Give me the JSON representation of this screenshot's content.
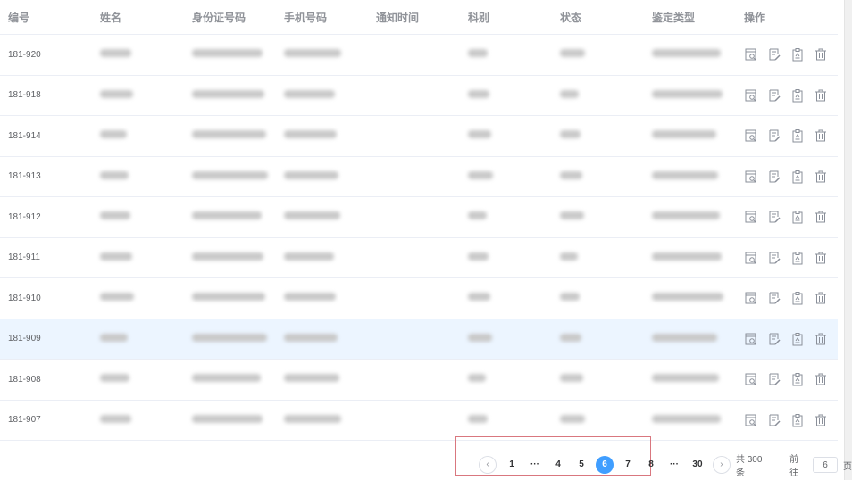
{
  "table": {
    "columns": [
      "编号",
      "姓名",
      "身份证号码",
      "手机号码",
      "通知时间",
      "科别",
      "状态",
      "鉴定类型",
      "操作"
    ],
    "rows": [
      {
        "id": "181-920"
      },
      {
        "id": "181-918"
      },
      {
        "id": "181-914"
      },
      {
        "id": "181-913"
      },
      {
        "id": "181-912"
      },
      {
        "id": "181-911"
      },
      {
        "id": "181-910"
      },
      {
        "id": "181-909",
        "highlighted": true
      },
      {
        "id": "181-908"
      },
      {
        "id": "181-907"
      }
    ],
    "row_actions": [
      "view-icon",
      "edit-icon",
      "clipboard-icon",
      "trash-icon"
    ],
    "highlight_color": "#ecf5ff"
  },
  "pagination": {
    "prev": "‹",
    "next": "›",
    "pages": [
      "1",
      "···",
      "4",
      "5",
      "6",
      "7",
      "8",
      "···",
      "30"
    ],
    "current": "6",
    "total": "共 300 条",
    "goto_label": "前往",
    "goto_value": "6",
    "goto_suffix": "页",
    "accent": "#409eff"
  }
}
